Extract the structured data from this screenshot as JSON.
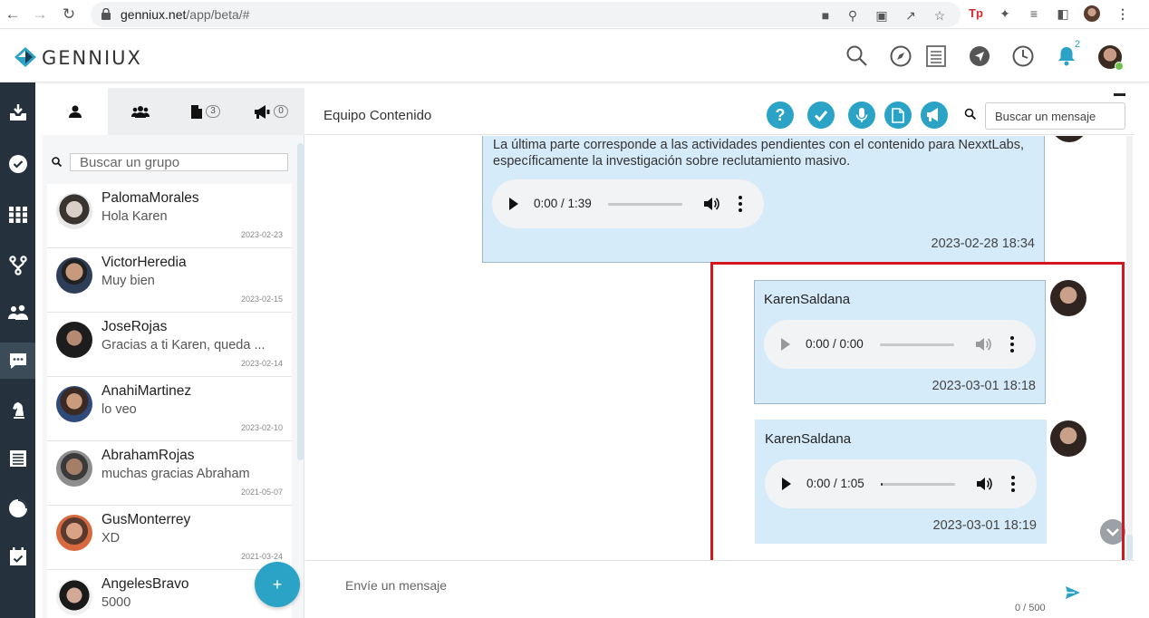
{
  "browser": {
    "url_host": "genniux.net",
    "url_path": "/app/beta/#"
  },
  "app": {
    "logo_text": "GENNIUX",
    "brand_color": "#2aa3c7",
    "notification_count": "2",
    "header_icons": [
      "search-icon",
      "compass-icon",
      "document-list-icon",
      "navigation-icon",
      "clock-icon",
      "bell-icon"
    ]
  },
  "sidenav": {
    "items": [
      "inbox-icon",
      "check-circle-icon",
      "grid-icon",
      "fork-icon",
      "team-icon",
      "chat-icon",
      "chess-knight-icon",
      "list-icon",
      "pie-chart-icon",
      "calendar-check-icon"
    ],
    "active": "chat-icon"
  },
  "contacts": {
    "tabs": [
      {
        "icon": "user-icon",
        "count": ""
      },
      {
        "icon": "group-icon",
        "count": ""
      },
      {
        "icon": "file-icon",
        "count": "3"
      },
      {
        "icon": "megaphone-icon",
        "count": "0"
      }
    ],
    "search_placeholder": "Buscar un grupo",
    "items": [
      {
        "name": "PalomaMorales",
        "message": "Hola Karen",
        "date": "2023-02-23"
      },
      {
        "name": "VictorHeredia",
        "message": "Muy bien",
        "date": "2023-02-15"
      },
      {
        "name": "JoseRojas",
        "message": "Gracias a ti Karen, queda ...",
        "date": "2023-02-14"
      },
      {
        "name": "AnahiMartinez",
        "message": "lo veo",
        "date": "2023-02-10"
      },
      {
        "name": "AbrahamRojas",
        "message": "muchas gracias Abraham",
        "date": "2021-05-07"
      },
      {
        "name": "GusMonterrey",
        "message": "XD",
        "date": "2021-03-24"
      },
      {
        "name": "AngelesBravo",
        "message": "5000",
        "date": ""
      }
    ],
    "fab_label": "+"
  },
  "chat": {
    "title": "Equipo Contenido",
    "help_label": "?",
    "search_placeholder": "Buscar un mensaje",
    "messages": [
      {
        "author": "",
        "text": "La última parte corresponde a las actividades pendientes con el contenido para NexxtLabs, específicamente la investigación sobre reclutamiento masivo.",
        "audio_time": "0:00 / 1:39",
        "audio_progress": 0,
        "date": "2023-02-28  18:34"
      },
      {
        "author": "KarenSaldana",
        "audio_time": "0:00 / 0:00",
        "audio_progress": 0,
        "audio_disabled": true,
        "date": "2023-03-01  18:18"
      },
      {
        "author": "KarenSaldana",
        "audio_time": "0:00 / 1:05",
        "audio_progress": 0.03,
        "date": "2023-03-01  18:19"
      }
    ],
    "composer_placeholder": "Envíe un mensaje",
    "char_counter": "0 / 500",
    "highlight_color": "#d4161e"
  }
}
